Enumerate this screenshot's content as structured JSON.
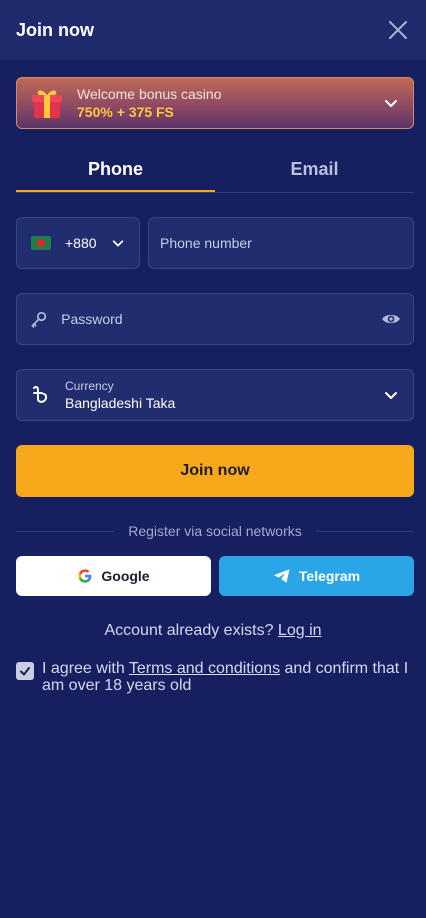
{
  "header": {
    "title": "Join now",
    "close_icon": "close-icon"
  },
  "bonus": {
    "title": "Welcome bonus casino",
    "value": "750% + 375 FS",
    "icon": "gift-icon"
  },
  "tabs": [
    {
      "label": "Phone",
      "active": true
    },
    {
      "label": "Email",
      "active": false
    }
  ],
  "phone": {
    "country_code": "+880",
    "flag": "bangladesh-flag",
    "placeholder": "Phone number",
    "value": ""
  },
  "password": {
    "placeholder": "Password",
    "value": ""
  },
  "currency": {
    "label": "Currency",
    "value": "Bangladeshi Taka"
  },
  "join_button": "Join now",
  "social": {
    "divider_text": "Register via social networks",
    "google": "Google",
    "telegram": "Telegram"
  },
  "account": {
    "text": "Account already exists?",
    "login_link": "Log in"
  },
  "agreement": {
    "checked": true,
    "prefix": "I agree with",
    "terms_link": "Terms and conditions",
    "suffix": "and confirm that I am over 18 years old"
  },
  "colors": {
    "background": "#162061",
    "accent": "#f7a81b",
    "telegram": "#2aa6e8",
    "bonus_value": "#ffc83d"
  }
}
